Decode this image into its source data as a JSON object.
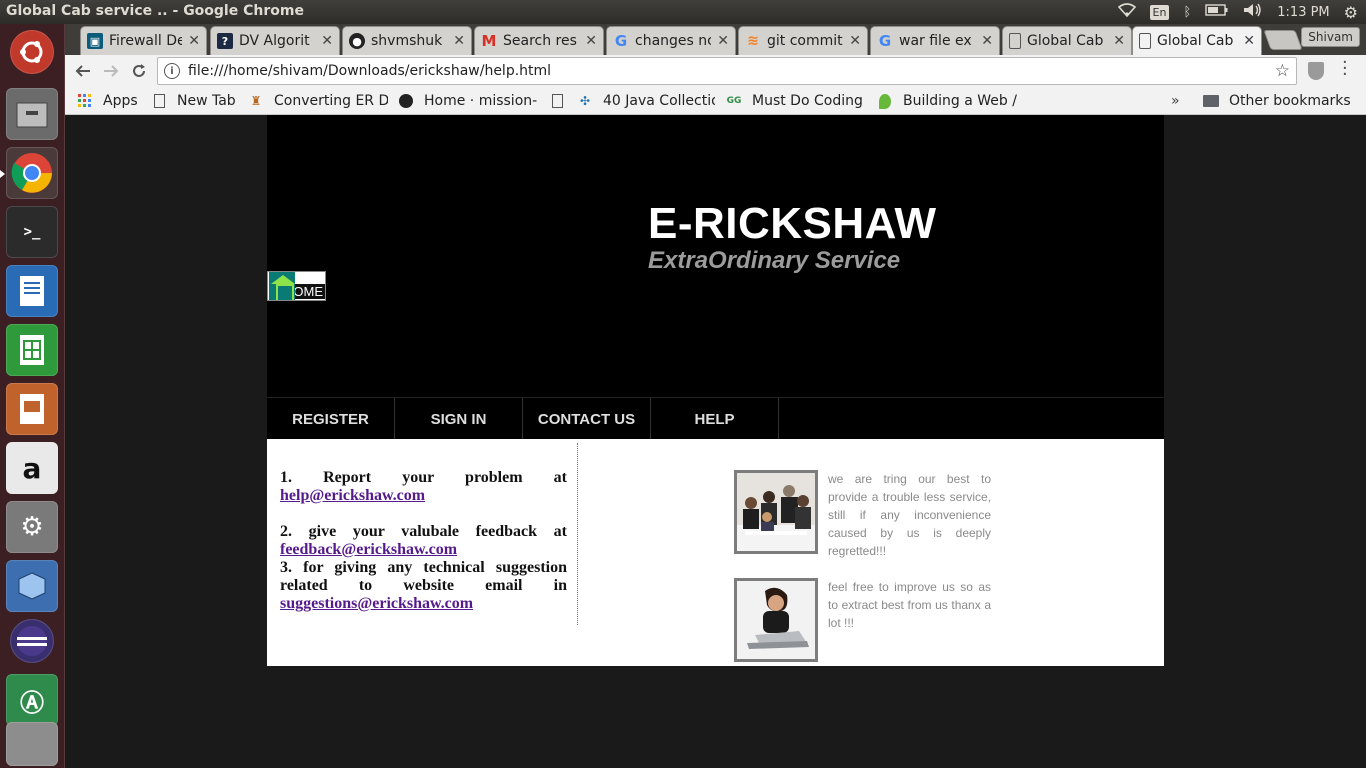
{
  "system": {
    "window_title": "Global Cab service .. - Google Chrome",
    "lang": "En",
    "time": "1:13 PM"
  },
  "tabs": [
    {
      "label": "Firewall De",
      "icon": "firewall-icon"
    },
    {
      "label": "DV Algorit",
      "icon": "question-icon"
    },
    {
      "label": "shvmshuk",
      "icon": "github-icon"
    },
    {
      "label": "Search res",
      "icon": "gmail-icon"
    },
    {
      "label": "changes nc",
      "icon": "google-icon"
    },
    {
      "label": "git commit",
      "icon": "stackoverflow-icon"
    },
    {
      "label": "war file ex",
      "icon": "google-icon"
    },
    {
      "label": "Global Cab",
      "icon": "page-icon"
    },
    {
      "label": "Global Cab",
      "icon": "page-icon"
    }
  ],
  "profile": "Shivam",
  "url": "file:///home/shivam/Downloads/erickshaw/help.html",
  "bookmarks": [
    {
      "label": "Apps",
      "icon": "apps-grid-icon"
    },
    {
      "label": "New Tab",
      "icon": "page-icon"
    },
    {
      "label": "Converting ER D",
      "icon": "bookmark-icon"
    },
    {
      "label": "Home · mission-",
      "icon": "github-icon"
    },
    {
      "label": "",
      "icon": "page-icon"
    },
    {
      "label": "40 Java Collectio",
      "icon": "java-icon"
    },
    {
      "label": "Must Do Coding",
      "icon": "gfg-icon"
    },
    {
      "label": "Building a Web /",
      "icon": "leaf-icon"
    }
  ],
  "other_bookmarks": "Other bookmarks",
  "site": {
    "title": "E-RICKSHAW",
    "tagline": "ExtraOrdinary Service",
    "home_label": "OME",
    "nav": [
      "REGISTER",
      "SIGN IN",
      "CONTACT US",
      "HELP"
    ],
    "help": {
      "item1_text": "1. Report your problem at",
      "item1_link": "help@erickshaw.com",
      "item2_text": "2. give your valubale feedback at",
      "item2_link": "feedback@erickshaw.com",
      "item3_text": "3. for giving any technical suggestion related to website email in",
      "item3_link": "suggestions@erickshaw.com"
    },
    "promo1": "we are tring our best to provide a trouble less service, still if any inconvenience caused by us is deeply regretted!!!",
    "promo2": "feel free to improve us so as to extract best from us thanx a lot !!!"
  }
}
